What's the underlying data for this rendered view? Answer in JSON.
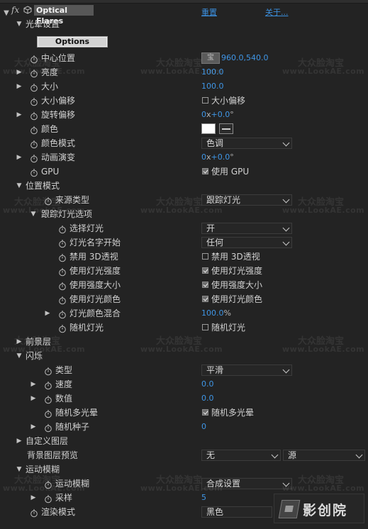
{
  "effect": {
    "name": "Optical Flares",
    "reset_label": "重置",
    "about_label": "关于..."
  },
  "watermark": {
    "line1": "大众脸淘宝",
    "line2": "www.LookAE.com"
  },
  "logo_text": "影创院",
  "rows": {
    "section_flare": "光晕设置",
    "options_button": "Options",
    "center_label": "中心位置",
    "center_value": "960.0,540.0",
    "center_point_icon": "宝",
    "brightness_label": "亮度",
    "brightness_value": "100.0",
    "scale_label": "大小",
    "scale_value": "100.0",
    "scale_offset_label": "大小偏移",
    "scale_offset_check": "大小偏移",
    "rotation_offset_label": "旋转偏移",
    "rotation_turns": "0",
    "rotation_x": "x",
    "rotation_deg": "+0.0",
    "rotation_unit": "°",
    "color_label": "颜色",
    "color_mode_label": "颜色模式",
    "color_mode_value": "色调",
    "anim_evol_label": "动画演变",
    "anim_turns": "0",
    "anim_x": "x",
    "anim_deg": "+0.0",
    "anim_unit": "°",
    "gpu_label": "GPU",
    "gpu_check": "使用 GPU",
    "section_position": "位置模式",
    "source_type_label": "来源类型",
    "source_type_value": "跟踪灯光",
    "track_lights_label": "跟踪灯光选项",
    "choose_light_label": "选择灯光",
    "choose_light_value": "开",
    "light_name_label": "灯光名字开始",
    "light_name_value": "任何",
    "disable_3d_label": "禁用 3D透视",
    "disable_3d_check": "禁用 3D透视",
    "use_intensity_label": "使用灯光强度",
    "use_intensity_check": "使用灯光强度",
    "intensity_scale_label": "使用强度大小",
    "intensity_scale_check": "使用强度大小",
    "use_light_color_label": "使用灯光颜色",
    "use_light_color_check": "使用灯光颜色",
    "light_color_mix_label": "灯光颜色混合",
    "light_color_mix_value": "100.0",
    "light_color_mix_unit": "%",
    "random_light_label": "随机灯光",
    "random_light_check": "随机灯光",
    "section_foreground": "前景层",
    "section_flicker": "闪烁",
    "flicker_type_label": "类型",
    "flicker_type_value": "平滑",
    "flicker_speed_label": "速度",
    "flicker_speed_value": "0.0",
    "flicker_amount_label": "数值",
    "flicker_amount_value": "0.0",
    "random_flares_label": "随机多光晕",
    "random_flares_check": "随机多光晕",
    "random_seed_label": "随机种子",
    "random_seed_value": "0",
    "section_custom_layers": "自定义图层",
    "bg_preview_label": "背景图层预览",
    "bg_preview_value1": "无",
    "bg_preview_value2": "源",
    "section_motion_blur": "运动模糊",
    "motion_blur_label": "运动模糊",
    "motion_blur_value": "合成设置",
    "samples_label": "采样",
    "samples_value": "5",
    "render_mode_label": "渲染模式",
    "render_mode_value": "黑色"
  },
  "colors": {
    "accent_value": "#3f96e6",
    "panel_bg": "#232323",
    "link": "#3b8edb",
    "swatch": "#ffffff"
  }
}
